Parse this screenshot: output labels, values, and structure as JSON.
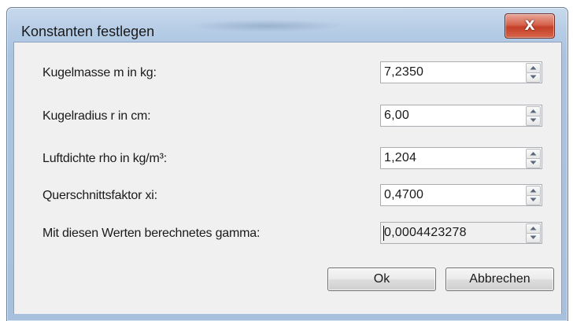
{
  "window": {
    "title": "Konstanten festlegen",
    "close_glyph": "X"
  },
  "fields": [
    {
      "label": "Kugelmasse m in kg:",
      "value": "7,2350",
      "readonly": false
    },
    {
      "label": "Kugelradius r in cm:",
      "value": "6,00",
      "readonly": false
    },
    {
      "label": "Luftdichte rho in kg/m³:",
      "value": "1,204",
      "readonly": false
    },
    {
      "label": "Querschnittsfaktor xi:",
      "value": "0,4700",
      "readonly": false
    },
    {
      "label": "Mit diesen Werten berechnetes gamma:",
      "value": "0,0004423278",
      "readonly": true
    }
  ],
  "buttons": {
    "ok_label": "Ok",
    "cancel_label": "Abbrechen"
  },
  "icons": {
    "close": "close-icon",
    "spin_up": "chevron-up-icon",
    "spin_down": "chevron-down-icon"
  },
  "colors": {
    "client_bg": "#f0f0f0",
    "close_button": "#c43f27",
    "frame": "#b7cde6"
  }
}
